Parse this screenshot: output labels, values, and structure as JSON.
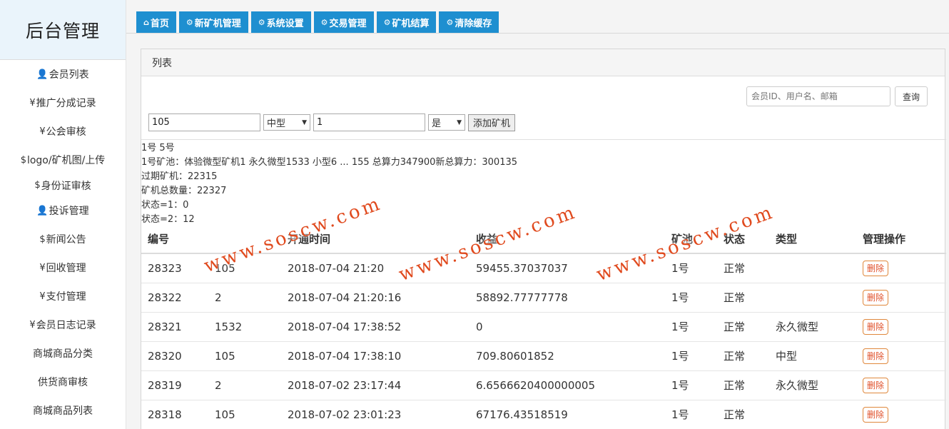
{
  "brand": {
    "title": "后台管理"
  },
  "sidebar": {
    "items": [
      {
        "icon": "user-icon",
        "glyph": "👤",
        "label": "会员列表"
      },
      {
        "icon": "yen-icon",
        "glyph": "¥",
        "label": " 推广分成记录"
      },
      {
        "icon": "yen-icon",
        "glyph": "¥",
        "label": " 公会审核"
      },
      {
        "icon": "dollar-icon",
        "glyph": "$",
        "label": "logo/矿机图/上传"
      },
      {
        "icon": "dollar-icon",
        "glyph": "$",
        "label": " 身份证审核"
      },
      {
        "icon": "user-icon",
        "glyph": "👤",
        "label": " 投诉管理"
      },
      {
        "icon": "dollar-icon",
        "glyph": "$",
        "label": " 新闻公告"
      },
      {
        "icon": "yen-icon",
        "glyph": "¥",
        "label": "回收管理"
      },
      {
        "icon": "yen-icon",
        "glyph": "¥",
        "label": " 支付管理"
      },
      {
        "icon": "yen-icon",
        "glyph": "¥",
        "label": " 会员日志记录"
      },
      {
        "icon": "",
        "glyph": "",
        "label": "商城商品分类"
      },
      {
        "icon": "",
        "glyph": "",
        "label": "供货商审核"
      },
      {
        "icon": "",
        "glyph": "",
        "label": "商城商品列表"
      }
    ]
  },
  "tabs": [
    {
      "icon": "home-icon",
      "glyph": "⌂",
      "label": "首页"
    },
    {
      "icon": "gears-icon",
      "glyph": "⚙",
      "label": "新矿机管理"
    },
    {
      "icon": "gears-icon",
      "glyph": "⚙",
      "label": "系统设置"
    },
    {
      "icon": "gears-icon",
      "glyph": "⚙",
      "label": "交易管理"
    },
    {
      "icon": "gears-icon",
      "glyph": "⚙",
      "label": "矿机结算"
    },
    {
      "icon": "gears-icon",
      "glyph": "⚙",
      "label": "清除缓存"
    }
  ],
  "panel": {
    "title": "列表"
  },
  "search": {
    "placeholder": "会员ID、用户名、邮箱",
    "button": "查询"
  },
  "add_form": {
    "user_id": "105",
    "type_selected": "中型",
    "quantity": "1",
    "flag_selected": "是",
    "button": "添加矿机"
  },
  "stats": [
    "1号 5号",
    "1号矿池：体验微型矿机1 永久微型1533 小型6 ... 155 总算力347900新总算力：300135",
    "过期矿机：22315",
    "矿机总数量：22327",
    "状态=1：0",
    "状态=2：12"
  ],
  "table": {
    "headers": [
      "编号",
      "",
      "开通时间",
      "收益",
      "矿池",
      "状态",
      "类型",
      "管理操作"
    ],
    "rows": [
      {
        "id": "28323",
        "user": "105",
        "time": "2018-07-04 21:20",
        "income": "59455.37037037",
        "pool": "1号",
        "status": "正常",
        "type": "",
        "action": "删除"
      },
      {
        "id": "28322",
        "user": "2",
        "time": "2018-07-04 21:20:16",
        "income": "58892.77777778",
        "pool": "1号",
        "status": "正常",
        "type": "",
        "action": "删除"
      },
      {
        "id": "28321",
        "user": "1532",
        "time": "2018-07-04 17:38:52",
        "income": "0",
        "pool": "1号",
        "status": "正常",
        "type": "永久微型",
        "action": "删除"
      },
      {
        "id": "28320",
        "user": "105",
        "time": "2018-07-04 17:38:10",
        "income": "709.80601852",
        "pool": "1号",
        "status": "正常",
        "type": "中型",
        "action": "删除"
      },
      {
        "id": "28319",
        "user": "2",
        "time": "2018-07-02 23:17:44",
        "income": "6.6566620400000005",
        "pool": "1号",
        "status": "正常",
        "type": "永久微型",
        "action": "删除"
      },
      {
        "id": "28318",
        "user": "105",
        "time": "2018-07-02 23:01:23",
        "income": "67176.43518519",
        "pool": "1号",
        "status": "正常",
        "type": "",
        "action": "删除"
      }
    ]
  },
  "watermarks": [
    "www.soscw.com",
    "www.soscw.com",
    "www.soscw.com"
  ],
  "colors": {
    "tab": "#1e8fd0",
    "delete": "#e0502a",
    "watermark": "#e04a1e"
  }
}
